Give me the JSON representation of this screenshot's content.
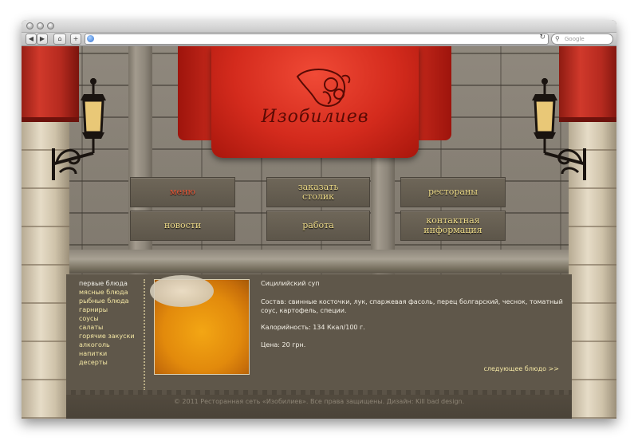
{
  "browser": {
    "search_placeholder": "Google",
    "reload_icon": "reload-icon"
  },
  "site": {
    "brand": "Изобилиев"
  },
  "nav": {
    "items": [
      {
        "label": "меню",
        "active": true
      },
      {
        "label": "заказать\nстолик",
        "active": false
      },
      {
        "label": "рестораны",
        "active": false
      },
      {
        "label": "новости",
        "active": false
      },
      {
        "label": "работа",
        "active": false
      },
      {
        "label": "контактная\nинформация",
        "active": false
      }
    ]
  },
  "categories": [
    "первые блюда",
    "мясные блюда",
    "рыбные блюда",
    "гарниры",
    "соусы",
    "салаты",
    "горячие закуски",
    "алкоголь",
    "напитки",
    "десерты"
  ],
  "dish": {
    "title": "Сицилийский суп",
    "composition": "Состав: свинные косточки, лук, спаржевая фасоль, перец болгарский, чеснок, томатный соус, картофель, специи.",
    "calories": "Калорийность: 134 Ккал/100 г.",
    "price": "Цена: 20 грн.",
    "next_link": "следующее блюдо >>"
  },
  "footer": {
    "text": "© 2011 Ресторанная сеть «Изобилиев». Все права защищены. Дизайн: Kill bad design."
  },
  "colors": {
    "accent_red": "#d42b1d",
    "menu_text": "#f0dd8a",
    "active_menu": "#e85a3a"
  }
}
